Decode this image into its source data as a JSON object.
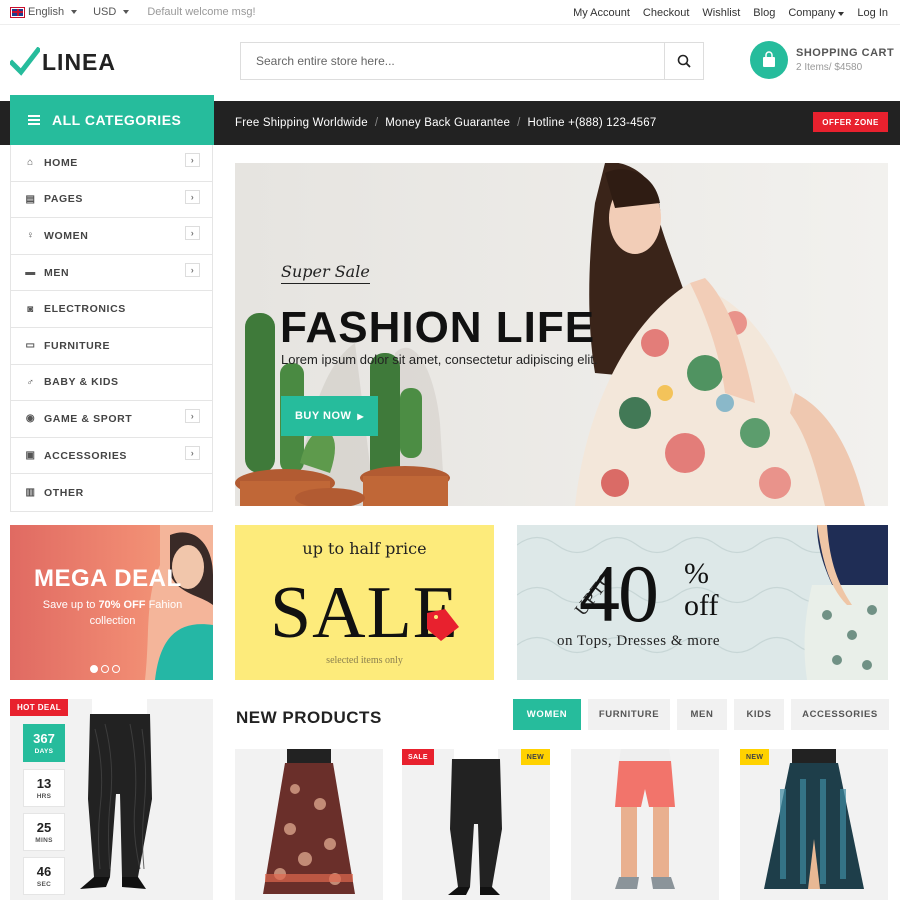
{
  "colors": {
    "accent": "#26bc9c",
    "dark": "#222222",
    "red": "#e8212e",
    "yellow": "#ffd200"
  },
  "topbar": {
    "language": "English",
    "currency": "USD",
    "welcome": "Default welcome msg!",
    "links": [
      "My Account",
      "Checkout",
      "Wishlist",
      "Blog",
      "Company",
      "Log In"
    ]
  },
  "logo": {
    "text": "LINEA",
    "icon": "checkmark-icon"
  },
  "search": {
    "placeholder": "Search entire store here...",
    "icon": "search-icon"
  },
  "cart": {
    "title": "SHOPPING CART",
    "summary": "2 Items/ $4580",
    "icon": "shopping-bag-icon"
  },
  "categories": {
    "title": "ALL CATEGORIES",
    "items": [
      {
        "label": "HOME",
        "icon": "home-icon",
        "has_sub": true
      },
      {
        "label": "PAGES",
        "icon": "file-icon",
        "has_sub": true
      },
      {
        "label": "WOMEN",
        "icon": "female-icon",
        "has_sub": true
      },
      {
        "label": "MEN",
        "icon": "briefcase-icon",
        "has_sub": true
      },
      {
        "label": "ELECTRONICS",
        "icon": "camera-icon",
        "has_sub": false
      },
      {
        "label": "FURNITURE",
        "icon": "bed-icon",
        "has_sub": false
      },
      {
        "label": "BABY & KIDS",
        "icon": "child-icon",
        "has_sub": false
      },
      {
        "label": "GAME & SPORT",
        "icon": "soccer-ball-icon",
        "has_sub": true
      },
      {
        "label": "ACCESSORIES",
        "icon": "bag-icon",
        "has_sub": true
      },
      {
        "label": "OTHER",
        "icon": "shopping-basket-icon",
        "has_sub": false
      }
    ]
  },
  "notice": {
    "items": [
      "Free Shipping Worldwide",
      "Money Back Guarantee",
      "Hotline +(888) 123-4567"
    ],
    "offer": "OFFER ZONE"
  },
  "hero": {
    "tag": "Super Sale",
    "title": "FASHION LIFE",
    "subtitle": "Lorem ipsum dolor sit amet, consectetur adipiscing elit.",
    "button": "BUY NOW"
  },
  "mega": {
    "title": "MEGA DEAL",
    "line1_prefix": "Save up to ",
    "highlight": "70% OFF",
    "line1_suffix": " Fahion",
    "line2": "collection",
    "dots": 3,
    "active_dot": 0
  },
  "sale": {
    "top": "up to half price",
    "main": "SALE",
    "bottom": "selected items only"
  },
  "forty": {
    "upto": "UPTO",
    "number": "40",
    "percent": "%",
    "off": "off",
    "sub": "on Tops, Dresses & more"
  },
  "hotdeal": {
    "badge": "HOT DEAL",
    "countdown": [
      {
        "value": "367",
        "unit": "DAYS"
      },
      {
        "value": "13",
        "unit": "HRS"
      },
      {
        "value": "25",
        "unit": "MINS"
      },
      {
        "value": "46",
        "unit": "SEC"
      }
    ]
  },
  "new_products": {
    "title": "NEW PRODUCTS",
    "tabs": [
      "WOMEN",
      "FURNITURE",
      "MEN",
      "KIDS",
      "ACCESSORIES"
    ],
    "active_tab": 0,
    "products": [
      {
        "badge": ""
      },
      {
        "badge": "SALE"
      },
      {
        "badge": "NEW"
      },
      {
        "badge": ""
      },
      {
        "badge": "NEW"
      }
    ]
  }
}
